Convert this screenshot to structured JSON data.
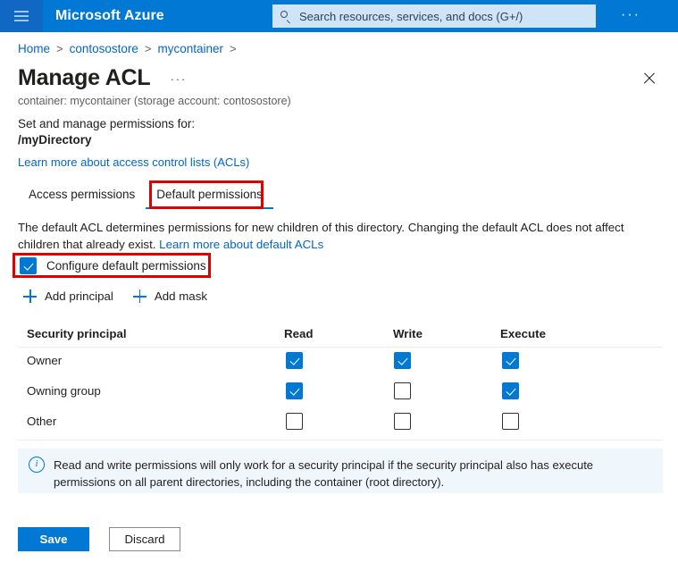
{
  "header": {
    "menu_icon": "hamburger-icon",
    "brand": "Microsoft Azure",
    "search": {
      "icon": "search-icon",
      "placeholder": "Search resources, services, and docs (G+/)",
      "value": ""
    },
    "more_label": "···"
  },
  "breadcrumb": {
    "items": [
      "Home",
      "contosostore",
      "mycontainer"
    ],
    "separator": ">"
  },
  "page": {
    "title": "Manage ACL",
    "title_more": "···",
    "close_icon": "close-icon",
    "subtitle": "container: mycontainer (storage account: contosostore)",
    "set_manage_label": "Set and manage permissions for:",
    "directory": "/myDirectory",
    "learn_more_acls": "Learn more about access control lists (ACLs)"
  },
  "tabs": [
    {
      "label": "Access permissions",
      "selected": false
    },
    {
      "label": "Default permissions",
      "selected": true
    }
  ],
  "description": {
    "text_before": "The default ACL determines permissions for new children of this directory. Changing the default ACL does not affect children that already exist. ",
    "link": "Learn more about default ACLs"
  },
  "configure": {
    "label": "Configure default permissions",
    "checked": true
  },
  "actions": [
    {
      "label": "Add principal",
      "icon": "plus-icon"
    },
    {
      "label": "Add mask",
      "icon": "plus-icon"
    }
  ],
  "table": {
    "columns": [
      "Security principal",
      "Read",
      "Write",
      "Execute"
    ],
    "rows": [
      {
        "principal": "Owner",
        "read": true,
        "write": true,
        "execute": true
      },
      {
        "principal": "Owning group",
        "read": true,
        "write": false,
        "execute": true
      },
      {
        "principal": "Other",
        "read": false,
        "write": false,
        "execute": false
      }
    ]
  },
  "info": {
    "icon": "info-icon",
    "text": "Read and write permissions will only work for a security principal if the security principal also has execute permissions on all parent directories, including the container (root directory)."
  },
  "footer": {
    "save_label": "Save",
    "discard_label": "Discard"
  },
  "annotations": {
    "tab_highlight_color": "#e00000",
    "checkbox_highlight_color": "#e00000"
  },
  "colors": {
    "azure_blue": "#0078d4",
    "link_blue": "#0066cc",
    "info_bg": "#eff6fc",
    "annotation_red": "#e00000"
  }
}
